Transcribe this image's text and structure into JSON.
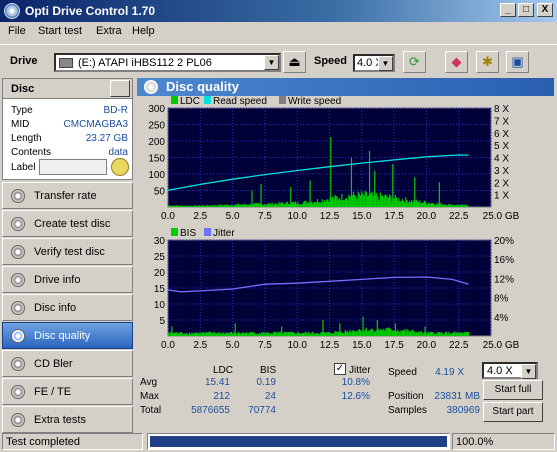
{
  "app": {
    "title": "Opti Drive Control 1.70",
    "window_buttons": [
      "_",
      "□",
      "X"
    ]
  },
  "menu": [
    "File",
    "Start test",
    "Extra",
    "Help"
  ],
  "drive": {
    "label": "Drive",
    "selected": "(E:)   ATAPI  iHBS112   2 PL06",
    "speed_label": "Speed",
    "speed_value": "4.0 X"
  },
  "disc": {
    "header": "Disc",
    "rows": [
      {
        "key": "Type",
        "value": "BD-R"
      },
      {
        "key": "MID",
        "value": "CMCMAGBA3"
      },
      {
        "key": "Length",
        "value": "23.27 GB"
      },
      {
        "key": "Contents",
        "value": "data"
      }
    ],
    "label_key": "Label",
    "label_value": ""
  },
  "nav": [
    {
      "label": "Transfer rate",
      "active": false
    },
    {
      "label": "Create test disc",
      "active": false
    },
    {
      "label": "Verify test disc",
      "active": false
    },
    {
      "label": "Drive info",
      "active": false
    },
    {
      "label": "Disc info",
      "active": false
    },
    {
      "label": "Disc quality",
      "active": true
    },
    {
      "label": "CD Bler",
      "active": false
    },
    {
      "label": "FE / TE",
      "active": false
    },
    {
      "label": "Extra tests",
      "active": false
    }
  ],
  "panel_title": "Disc quality",
  "chart_data": [
    {
      "type": "bar",
      "legend": [
        "LDC",
        "Read speed",
        "Write speed"
      ],
      "x": [
        0.0,
        2.5,
        5.0,
        7.5,
        10.0,
        12.5,
        15.0,
        17.5,
        20.0,
        22.5,
        25.0
      ],
      "x_tick_labels": [
        "0.0",
        "2.5",
        "5.0",
        "7.5",
        "10.0",
        "12.5",
        "15.0",
        "17.5",
        "20.0",
        "22.5",
        "25.0 GB"
      ],
      "y_left_ticks": [
        "50",
        "100",
        "150",
        "200",
        "250",
        "300"
      ],
      "y_right_ticks": [
        "1 X",
        "2 X",
        "3 X",
        "4 X",
        "5 X",
        "6 X",
        "7 X",
        "8 X"
      ],
      "ylim": [
        0,
        300
      ],
      "ylim_right": [
        0,
        8
      ],
      "xlim": [
        0,
        25
      ],
      "series": [
        {
          "name": "LDC",
          "color": "#00cc00",
          "x": [
            0,
            1,
            2,
            3,
            4,
            5,
            6,
            7,
            8,
            9,
            10,
            11,
            12,
            13,
            14,
            15,
            16,
            17,
            18,
            19,
            20,
            21,
            22,
            23.27
          ],
          "values": [
            5,
            4,
            4,
            5,
            6,
            7,
            8,
            9,
            10,
            12,
            13,
            16,
            22,
            28,
            34,
            36,
            34,
            30,
            24,
            18,
            14,
            10,
            7,
            5
          ]
        },
        {
          "name": "Read speed",
          "color": "#00e0e0",
          "x": [
            0,
            2.5,
            5,
            7.5,
            10,
            12.5,
            15,
            17.5,
            20,
            22.5,
            23.27
          ],
          "values": [
            1.35,
            1.83,
            2.25,
            2.62,
            2.95,
            3.26,
            3.55,
            3.81,
            4.06,
            4.2,
            4.19
          ]
        }
      ],
      "spikes": [
        {
          "x": 6.5,
          "y": 50
        },
        {
          "x": 7.2,
          "y": 70
        },
        {
          "x": 9.5,
          "y": 60
        },
        {
          "x": 11.0,
          "y": 80
        },
        {
          "x": 12.6,
          "y": 212
        },
        {
          "x": 14.2,
          "y": 150
        },
        {
          "x": 15.6,
          "y": 170
        },
        {
          "x": 16.0,
          "y": 110
        },
        {
          "x": 17.4,
          "y": 130
        },
        {
          "x": 19.1,
          "y": 90
        },
        {
          "x": 21.0,
          "y": 75
        }
      ],
      "grid": true
    },
    {
      "type": "bar",
      "legend": [
        "BIS",
        "Jitter"
      ],
      "x_tick_labels": [
        "0.0",
        "2.5",
        "5.0",
        "7.5",
        "10.0",
        "12.5",
        "15.0",
        "17.5",
        "20.0",
        "22.5",
        "25.0 GB"
      ],
      "y_left_ticks": [
        "5",
        "10",
        "15",
        "20",
        "25",
        "30"
      ],
      "y_right_ticks": [
        "4%",
        "8%",
        "12%",
        "16%",
        "20%"
      ],
      "ylim": [
        0,
        30
      ],
      "ylim_right": [
        0,
        20
      ],
      "xlim": [
        0,
        25
      ],
      "series": [
        {
          "name": "BIS",
          "color": "#00cc00",
          "x": [
            0,
            2.5,
            5,
            7.5,
            10,
            12.5,
            15,
            17.5,
            20,
            22.5,
            23.27
          ],
          "values": [
            1,
            1,
            1,
            1,
            1,
            1,
            2,
            2,
            1,
            1,
            1
          ]
        },
        {
          "name": "Jitter",
          "color": "#7070ff",
          "x": [
            0,
            1,
            2.5,
            5,
            7.5,
            10,
            12.5,
            15,
            17.5,
            20,
            22,
            22.5,
            23.27
          ],
          "values": [
            9.6,
            9.2,
            9.4,
            9.8,
            10.8,
            11.0,
            11.4,
            11.8,
            12.2,
            12.3,
            11.8,
            11.4,
            10.8
          ]
        }
      ],
      "spikes": [
        {
          "x": 0.3,
          "y": 3
        },
        {
          "x": 5.2,
          "y": 4
        },
        {
          "x": 8.8,
          "y": 3
        },
        {
          "x": 12.0,
          "y": 5
        },
        {
          "x": 13.3,
          "y": 4
        },
        {
          "x": 15.1,
          "y": 6
        },
        {
          "x": 16.2,
          "y": 5
        },
        {
          "x": 17.6,
          "y": 4
        },
        {
          "x": 19.9,
          "y": 3
        }
      ],
      "grid": true
    }
  ],
  "stats": {
    "col_ldc": "LDC",
    "col_bis": "BIS",
    "jitter_label": "Jitter",
    "jitter_checked": "✓",
    "rows": [
      {
        "label": "Avg",
        "ldc": "15.41",
        "bis": "0.19",
        "jitter": "10.8%"
      },
      {
        "label": "Max",
        "ldc": "212",
        "bis": "24",
        "jitter": "12.6%"
      },
      {
        "label": "Total",
        "ldc": "5876655",
        "bis": "70774",
        "jitter": ""
      }
    ],
    "speed_label": "Speed",
    "speed_value": "4.19 X",
    "speed_select": "4.0 X",
    "position_label": "Position",
    "position_value": "23831 MB",
    "samples_label": "Samples",
    "samples_value": "380969",
    "start_full": "Start full",
    "start_part": "Start part"
  },
  "status": {
    "text": "Test completed",
    "progress": 1.0,
    "percent": "100.0%"
  }
}
